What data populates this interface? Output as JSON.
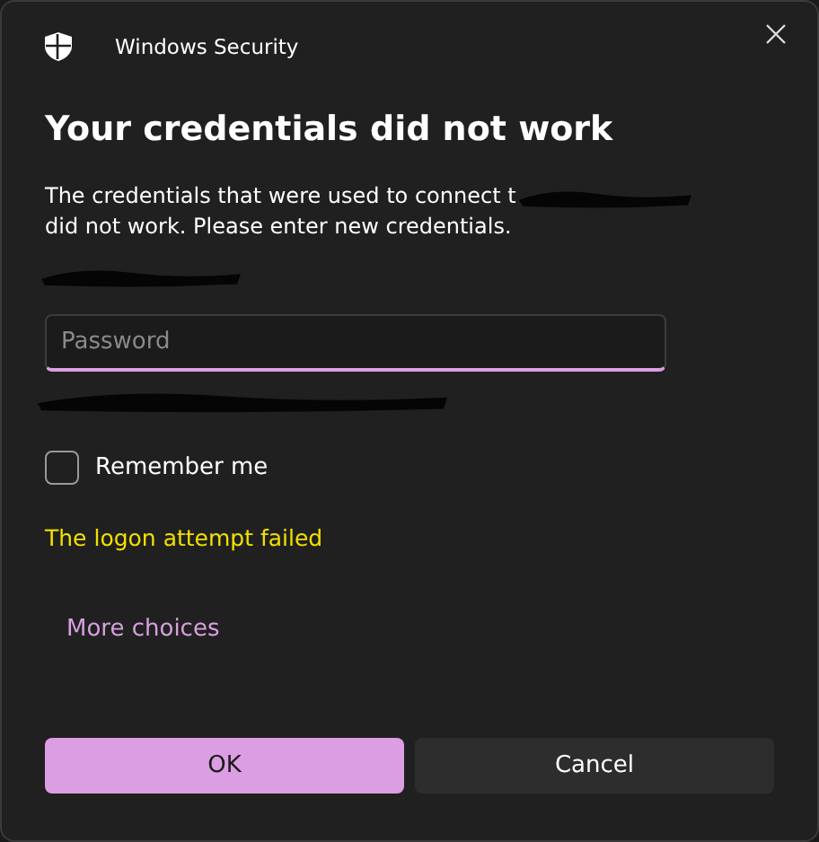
{
  "window": {
    "title": "Windows Security"
  },
  "heading": "Your credentials did not work",
  "message": {
    "line_1": "The credentials that were used to connect t",
    "line_2": "did not work. Please enter new credentials."
  },
  "password": {
    "placeholder": "Password"
  },
  "remember_me": {
    "label": "Remember me",
    "checked": false
  },
  "error": "The logon attempt failed",
  "more_choices": "More choices",
  "buttons": [
    {
      "label": "OK",
      "kind": "primary"
    },
    {
      "label": "Cancel",
      "kind": "secondary"
    }
  ]
}
